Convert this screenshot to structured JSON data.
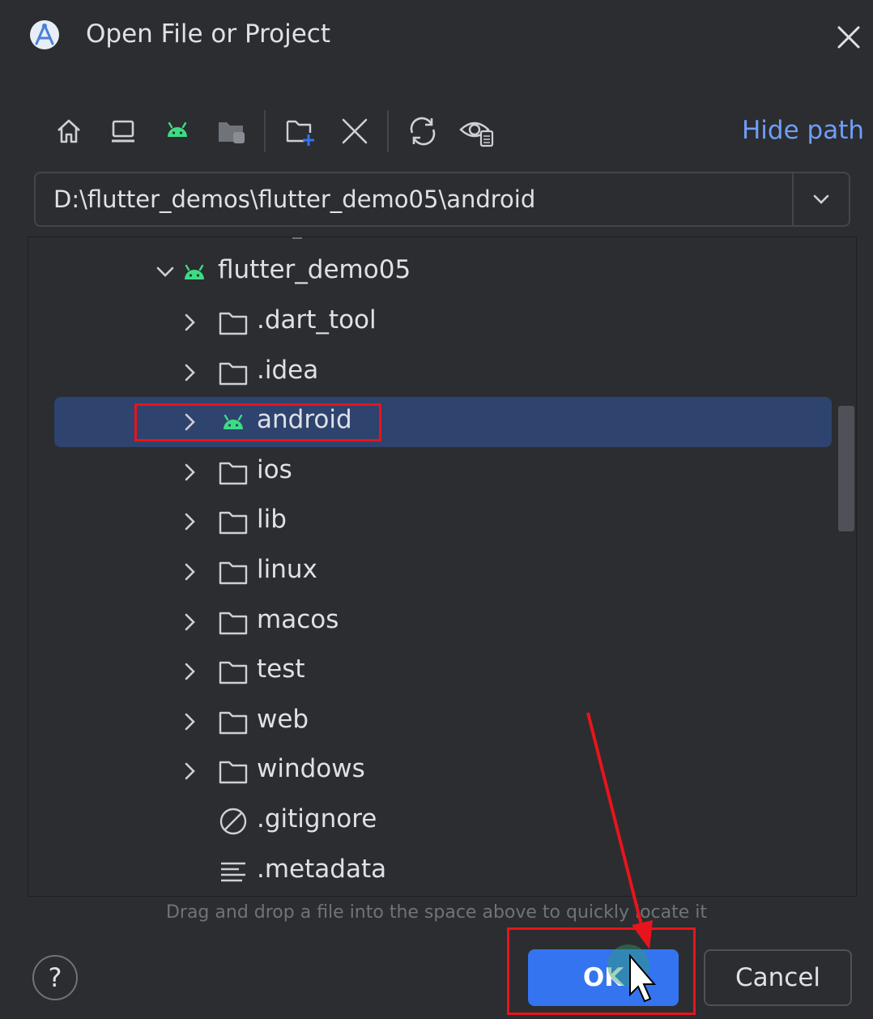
{
  "window": {
    "title": "Open File or Project",
    "close_icon": "close-icon",
    "app_icon": "android-studio-icon"
  },
  "toolbar": {
    "buttons": [
      "home-icon",
      "desktop-icon",
      "android-project-icon",
      "module-folder-icon",
      "new-folder-icon",
      "delete-icon",
      "refresh-icon",
      "show-hidden-icon"
    ],
    "hide_path_label": "Hide path"
  },
  "path": {
    "value": "D:\\flutter_demos\\flutter_demo05\\android"
  },
  "tree": {
    "root": {
      "label": "flutter_demo05",
      "expanded": true,
      "icon": "android-icon"
    },
    "items": [
      {
        "label": ".dart_tool",
        "icon": "folder-icon",
        "expandable": true
      },
      {
        "label": ".idea",
        "icon": "folder-icon",
        "expandable": true
      },
      {
        "label": "android",
        "icon": "android-icon",
        "expandable": true,
        "selected": true
      },
      {
        "label": "ios",
        "icon": "folder-icon",
        "expandable": true
      },
      {
        "label": "lib",
        "icon": "folder-icon",
        "expandable": true
      },
      {
        "label": "linux",
        "icon": "folder-icon",
        "expandable": true
      },
      {
        "label": "macos",
        "icon": "folder-icon",
        "expandable": true
      },
      {
        "label": "test",
        "icon": "folder-icon",
        "expandable": true
      },
      {
        "label": "web",
        "icon": "folder-icon",
        "expandable": true
      },
      {
        "label": "windows",
        "icon": "folder-icon",
        "expandable": true
      },
      {
        "label": ".gitignore",
        "icon": "ignored-file-icon",
        "expandable": false
      },
      {
        "label": ".metadata",
        "icon": "text-file-icon",
        "expandable": false
      }
    ]
  },
  "hint": "Drag and drop a file into the space above to quickly locate it",
  "footer": {
    "help_label": "?",
    "ok_label": "OK",
    "cancel_label": "Cancel"
  },
  "colors": {
    "background": "#2b2d30",
    "selection": "#2e436e",
    "accent": "#3574f0",
    "link": "#6f9ef8",
    "android_green": "#3ddc84",
    "annotation_red": "#e8141c"
  }
}
